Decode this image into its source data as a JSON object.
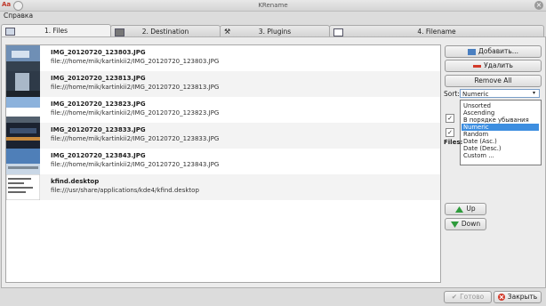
{
  "window": {
    "title": "KRename",
    "app_icon": "Aa"
  },
  "menu": {
    "help": "Справка"
  },
  "tabs": [
    {
      "label": "1. Files",
      "active": true
    },
    {
      "label": "2. Destination"
    },
    {
      "label": "3. Plugins"
    },
    {
      "label": "4. Filename"
    }
  ],
  "files": [
    {
      "name": "IMG_20120720_123803.JPG",
      "path": "file:///home/mik/kartinkii2/IMG_20120720_123803.JPG"
    },
    {
      "name": "IMG_20120720_123813.JPG",
      "path": "file:///home/mik/kartinkii2/IMG_20120720_123813.JPG"
    },
    {
      "name": "IMG_20120720_123823.JPG",
      "path": "file:///home/mik/kartinkii2/IMG_20120720_123823.JPG"
    },
    {
      "name": "IMG_20120720_123833.JPG",
      "path": "file:///home/mik/kartinkii2/IMG_20120720_123833.JPG"
    },
    {
      "name": "IMG_20120720_123843.JPG",
      "path": "file:///home/mik/kartinkii2/IMG_20120720_123843.JPG"
    },
    {
      "name": "kfind.desktop",
      "path": "file:///usr/share/applications/kde4/kfind.desktop"
    }
  ],
  "buttons": {
    "add": "Добавить...",
    "remove": "Удалить",
    "remove_all": "Remove All",
    "up": "Up",
    "down": "Down",
    "finish": "Готово",
    "close": "Закрыть"
  },
  "sort": {
    "label": "Sort:",
    "selected": "Numeric",
    "options": [
      "Unsorted",
      "Ascending",
      "В порядке убывания",
      "Numeric",
      "Random",
      "Date (Asc.)",
      "Date (Desc.)",
      "Custom ..."
    ]
  },
  "files_label": "Files:",
  "colors": {
    "selection": "#3d8ee0",
    "accent_green": "#2e9b3c",
    "close_red": "#d23a2a"
  }
}
